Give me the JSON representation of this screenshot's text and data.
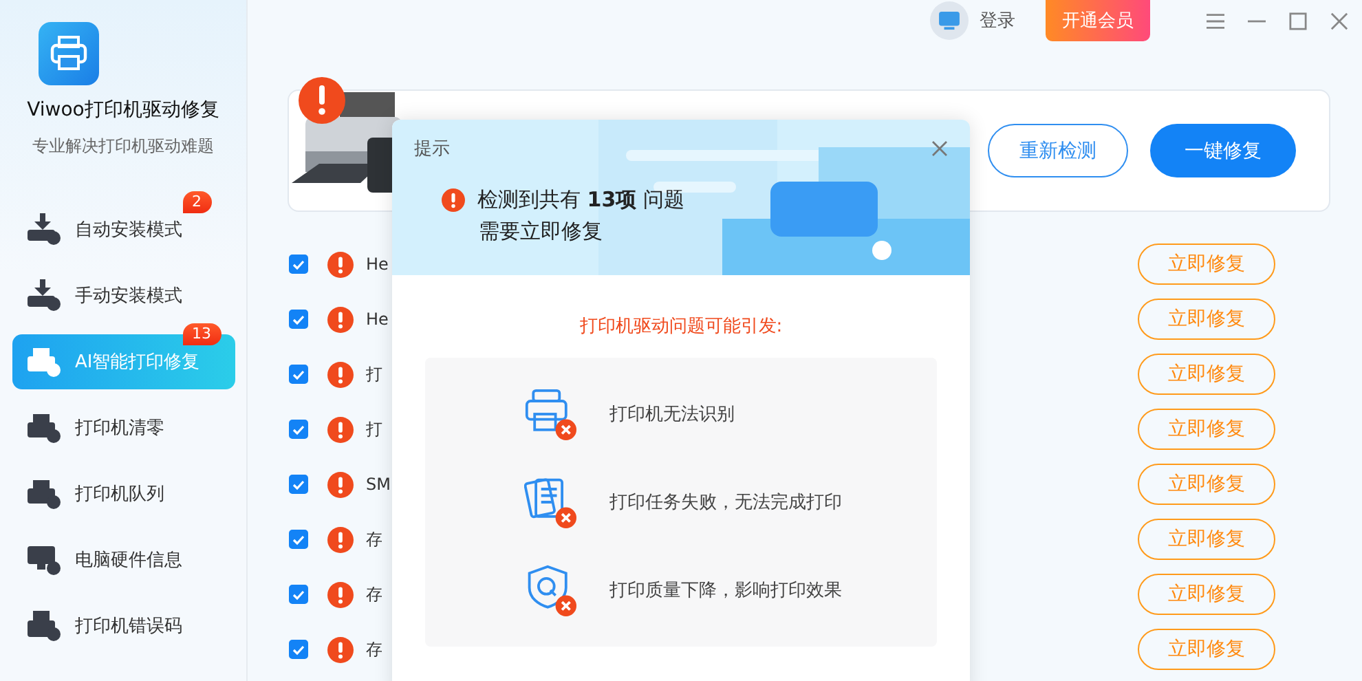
{
  "app": {
    "name": "Viwoo打印机驱动修复",
    "tagline": "专业解决打印机驱动难题"
  },
  "sidebar": {
    "items": [
      {
        "label": "自动安装模式",
        "selected": false,
        "badge": "2"
      },
      {
        "label": "手动安装模式",
        "selected": false
      },
      {
        "label": "AI智能打印修复",
        "selected": true,
        "badge": "13"
      },
      {
        "label": "打印机清零",
        "selected": false
      },
      {
        "label": "打印机队列",
        "selected": false
      },
      {
        "label": "电脑硬件信息",
        "selected": false
      },
      {
        "label": "打印机错误码",
        "selected": false
      }
    ]
  },
  "topbar": {
    "login": "登录",
    "vip": "开通会员"
  },
  "banner": {
    "buttons": [
      {
        "label": "重新检测",
        "kind": "outline"
      },
      {
        "label": "一键修复",
        "kind": "primary"
      }
    ]
  },
  "issues": [
    {
      "text": "He",
      "checked": true,
      "action": "立即修复"
    },
    {
      "text": "He",
      "checked": true,
      "action": "立即修复"
    },
    {
      "text": "打",
      "checked": true,
      "action": "立即修复"
    },
    {
      "text": "打",
      "checked": true,
      "action": "立即修复"
    },
    {
      "text": "SM",
      "checked": true,
      "action": "立即修复"
    },
    {
      "text": "存",
      "checked": true,
      "action": "立即修复"
    },
    {
      "text": "存",
      "checked": true,
      "action": "立即修复"
    },
    {
      "text": "存",
      "checked": true,
      "action": "立即修复"
    }
  ],
  "dialog": {
    "title": "提示",
    "summary": "检测到共有 **13项** 问题",
    "summary_2": "需要立即修复",
    "heading": "打印机驱动问题可能引发:",
    "effects": [
      {
        "text": "打印机无法识别"
      },
      {
        "text": "打印任务失败，无法完成打印"
      },
      {
        "text": "打印质量下降，影响打印效果"
      }
    ]
  }
}
